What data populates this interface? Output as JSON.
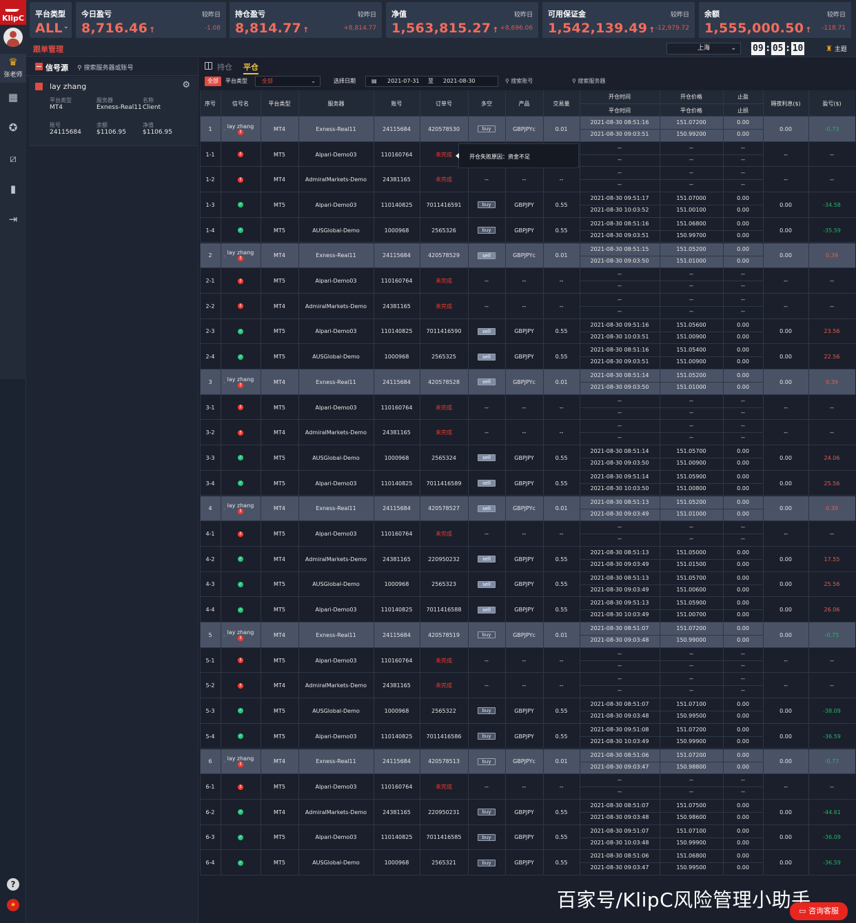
{
  "brand": {
    "logo_text": "KlipC",
    "teacher_label": "张老师",
    "accent": "#e24b40"
  },
  "nav_icons": [
    "dashboard-icon",
    "badge-icon",
    "chart-icon",
    "bar-chart-icon",
    "logout-icon"
  ],
  "footer_icons": {
    "help": "?",
    "flag": "★"
  },
  "stats": [
    {
      "title": "平台类型",
      "value": "ALL",
      "compare": "",
      "delta": ""
    },
    {
      "title": "今日盈亏",
      "value": "8,716.46",
      "compare": "较昨日",
      "delta": "-1.08"
    },
    {
      "title": "持仓盈亏",
      "value": "8,814.77",
      "compare": "较昨日",
      "delta": "+8,814.77"
    },
    {
      "title": "净值",
      "value": "1,563,815.27",
      "compare": "较昨日",
      "delta": "+8,696.06"
    },
    {
      "title": "可用保证金",
      "value": "1,542,139.49",
      "compare": "较昨日",
      "delta": "-12,979.72"
    },
    {
      "title": "余额",
      "value": "1,555,000.50",
      "compare": "较昨日",
      "delta": "-118.71"
    }
  ],
  "subbar": {
    "title": "跟单管理",
    "region": "上海",
    "clock": [
      "09",
      "05",
      "10"
    ],
    "theme": "主题"
  },
  "left_panel": {
    "title": "信号源",
    "search_placeholder": "搜索服务器或账号",
    "trader": {
      "name": "lay zhang",
      "fields": [
        {
          "k": "平台类型",
          "v": "MT4"
        },
        {
          "k": "服务器",
          "v": "Exness-Real11"
        },
        {
          "k": "名称",
          "v": "Client"
        },
        {
          "k": "账号",
          "v": "24115684"
        },
        {
          "k": "余额",
          "v": "$1106.95"
        },
        {
          "k": "净值",
          "v": "$1106.95"
        }
      ]
    }
  },
  "tabs": {
    "hold": "持仓",
    "close": "平仓"
  },
  "filters": {
    "all": "全部",
    "platform_label": "平台类型",
    "platform_value": "全部",
    "date_label": "选择日期",
    "date_from": "2021-07-31",
    "date_sep": "至",
    "date_to": "2021-08-30",
    "search_account": "搜索账号",
    "search_server": "搜索服务器"
  },
  "columns": {
    "idx": "序号",
    "signal": "信号名",
    "platform": "平台类型",
    "server": "服务器",
    "account": "账号",
    "order": "订单号",
    "side": "多空",
    "product": "产品",
    "lots": "交易量",
    "open_time": "开仓时间",
    "close_time": "平仓时间",
    "open_price": "开仓价格",
    "close_price": "平仓价格",
    "sl": "止盈",
    "tp": "止损",
    "swap": "隔夜利息($)",
    "pnl": "盈亏($)"
  },
  "tooltip": "开仓失败原因：资金不足",
  "rows": [
    {
      "idx": "1",
      "name": "lay zhang",
      "status": "warn",
      "platform": "MT4",
      "server": "Exness-Real11",
      "account": "24115684",
      "order": "420578530",
      "side": "buy",
      "product": "GBPJPYc",
      "lots": "0.01",
      "ot": "2021-08-30 08:51:16",
      "ct": "2021-08-30 09:03:51",
      "op": "151.07200",
      "cp": "150.99200",
      "sl": "0.00",
      "tp": "0.00",
      "swap": "0.00",
      "pnl": "-0.73",
      "parent": true
    },
    {
      "idx": "1-1",
      "status": "warn",
      "platform": "MT5",
      "server": "Alpari-Demo03",
      "account": "110160764",
      "order": "未完成",
      "side": "--",
      "product": "--",
      "lots": "--",
      "ot": "--",
      "ct": "--",
      "op": "--",
      "cp": "--",
      "sl": "--",
      "tp": "--",
      "swap": "--",
      "pnl": "--"
    },
    {
      "idx": "1-2",
      "status": "warn",
      "platform": "MT4",
      "server": "AdmiralMarkets-Demo",
      "account": "24381165",
      "order": "未完成",
      "side": "--",
      "product": "--",
      "lots": "--",
      "ot": "--",
      "ct": "--",
      "op": "--",
      "cp": "--",
      "sl": "--",
      "tp": "--",
      "swap": "--",
      "pnl": "--"
    },
    {
      "idx": "1-3",
      "status": "ok",
      "platform": "MT5",
      "server": "Alpari-Demo03",
      "account": "110140825",
      "order": "7011416591",
      "side": "buy",
      "product": "GBPJPY",
      "lots": "0.55",
      "ot": "2021-08-30 09:51:17",
      "ct": "2021-08-30 10:03:52",
      "op": "151.07000",
      "cp": "151.00100",
      "sl": "0.00",
      "tp": "0.00",
      "swap": "0.00",
      "pnl": "-34.58"
    },
    {
      "idx": "1-4",
      "status": "ok",
      "platform": "MT5",
      "server": "AUSGlobal-Demo",
      "account": "1000968",
      "order": "2565326",
      "side": "buy",
      "product": "GBPJPY",
      "lots": "0.55",
      "ot": "2021-08-30 08:51:16",
      "ct": "2021-08-30 09:03:51",
      "op": "151.06800",
      "cp": "150.99700",
      "sl": "0.00",
      "tp": "0.00",
      "swap": "0.00",
      "pnl": "-35.59"
    },
    {
      "idx": "2",
      "name": "lay zhang",
      "status": "warn",
      "platform": "MT4",
      "server": "Exness-Real11",
      "account": "24115684",
      "order": "420578529",
      "side": "sell",
      "product": "GBPJPYc",
      "lots": "0.01",
      "ot": "2021-08-30 08:51:15",
      "ct": "2021-08-30 09:03:50",
      "op": "151.05200",
      "cp": "151.01000",
      "sl": "0.00",
      "tp": "0.00",
      "swap": "0.00",
      "pnl": "0.39",
      "parent": true
    },
    {
      "idx": "2-1",
      "status": "warn",
      "platform": "MT5",
      "server": "Alpari-Demo03",
      "account": "110160764",
      "order": "未完成",
      "side": "--",
      "product": "--",
      "lots": "--",
      "ot": "--",
      "ct": "--",
      "op": "--",
      "cp": "--",
      "sl": "--",
      "tp": "--",
      "swap": "--",
      "pnl": "--"
    },
    {
      "idx": "2-2",
      "status": "warn",
      "platform": "MT4",
      "server": "AdmiralMarkets-Demo",
      "account": "24381165",
      "order": "未完成",
      "side": "--",
      "product": "--",
      "lots": "--",
      "ot": "--",
      "ct": "--",
      "op": "--",
      "cp": "--",
      "sl": "--",
      "tp": "--",
      "swap": "--",
      "pnl": "--"
    },
    {
      "idx": "2-3",
      "status": "ok",
      "platform": "MT5",
      "server": "Alpari-Demo03",
      "account": "110140825",
      "order": "7011416590",
      "side": "sell",
      "product": "GBPJPY",
      "lots": "0.55",
      "ot": "2021-08-30 09:51:16",
      "ct": "2021-08-30 10:03:51",
      "op": "151.05600",
      "cp": "151.00900",
      "sl": "0.00",
      "tp": "0.00",
      "swap": "0.00",
      "pnl": "23.56"
    },
    {
      "idx": "2-4",
      "status": "ok",
      "platform": "MT5",
      "server": "AUSGlobal-Demo",
      "account": "1000968",
      "order": "2565325",
      "side": "sell",
      "product": "GBPJPY",
      "lots": "0.55",
      "ot": "2021-08-30 08:51:16",
      "ct": "2021-08-30 09:03:51",
      "op": "151.05400",
      "cp": "151.00900",
      "sl": "0.00",
      "tp": "0.00",
      "swap": "0.00",
      "pnl": "22.56"
    },
    {
      "idx": "3",
      "name": "lay zhang",
      "status": "warn",
      "platform": "MT4",
      "server": "Exness-Real11",
      "account": "24115684",
      "order": "420578528",
      "side": "sell",
      "product": "GBPJPYc",
      "lots": "0.01",
      "ot": "2021-08-30 08:51:14",
      "ct": "2021-08-30 09:03:50",
      "op": "151.05200",
      "cp": "151.01000",
      "sl": "0.00",
      "tp": "0.00",
      "swap": "0.00",
      "pnl": "0.39",
      "parent": true
    },
    {
      "idx": "3-1",
      "status": "warn",
      "platform": "MT5",
      "server": "Alpari-Demo03",
      "account": "110160764",
      "order": "未完成",
      "side": "--",
      "product": "--",
      "lots": "--",
      "ot": "--",
      "ct": "--",
      "op": "--",
      "cp": "--",
      "sl": "--",
      "tp": "--",
      "swap": "--",
      "pnl": "--"
    },
    {
      "idx": "3-2",
      "status": "warn",
      "platform": "MT4",
      "server": "AdmiralMarkets-Demo",
      "account": "24381165",
      "order": "未完成",
      "side": "--",
      "product": "--",
      "lots": "--",
      "ot": "--",
      "ct": "--",
      "op": "--",
      "cp": "--",
      "sl": "--",
      "tp": "--",
      "swap": "--",
      "pnl": "--"
    },
    {
      "idx": "3-3",
      "status": "ok",
      "platform": "MT5",
      "server": "AUSGlobal-Demo",
      "account": "1000968",
      "order": "2565324",
      "side": "sell",
      "product": "GBPJPY",
      "lots": "0.55",
      "ot": "2021-08-30 08:51:14",
      "ct": "2021-08-30 09:03:50",
      "op": "151.05700",
      "cp": "151.00900",
      "sl": "0.00",
      "tp": "0.00",
      "swap": "0.00",
      "pnl": "24.06"
    },
    {
      "idx": "3-4",
      "status": "ok",
      "platform": "MT5",
      "server": "Alpari-Demo03",
      "account": "110140825",
      "order": "7011416589",
      "side": "sell",
      "product": "GBPJPY",
      "lots": "0.55",
      "ot": "2021-08-30 09:51:14",
      "ct": "2021-08-30 10:03:50",
      "op": "151.05900",
      "cp": "151.00800",
      "sl": "0.00",
      "tp": "0.00",
      "swap": "0.00",
      "pnl": "25.56"
    },
    {
      "idx": "4",
      "name": "lay zhang",
      "status": "warn",
      "platform": "MT4",
      "server": "Exness-Real11",
      "account": "24115684",
      "order": "420578527",
      "side": "sell",
      "product": "GBPJPYc",
      "lots": "0.01",
      "ot": "2021-08-30 08:51:13",
      "ct": "2021-08-30 09:03:49",
      "op": "151.05200",
      "cp": "151.01000",
      "sl": "0.00",
      "tp": "0.00",
      "swap": "0.00",
      "pnl": "0.39",
      "parent": true
    },
    {
      "idx": "4-1",
      "status": "warn",
      "platform": "MT5",
      "server": "Alpari-Demo03",
      "account": "110160764",
      "order": "未完成",
      "side": "--",
      "product": "--",
      "lots": "--",
      "ot": "--",
      "ct": "--",
      "op": "--",
      "cp": "--",
      "sl": "--",
      "tp": "--",
      "swap": "--",
      "pnl": "--"
    },
    {
      "idx": "4-2",
      "status": "ok",
      "platform": "MT4",
      "server": "AdmiralMarkets-Demo",
      "account": "24381165",
      "order": "220950232",
      "side": "sell",
      "product": "GBPJPY",
      "lots": "0.55",
      "ot": "2021-08-30 08:51:13",
      "ct": "2021-08-30 09:03:49",
      "op": "151.05000",
      "cp": "151.01500",
      "sl": "0.00",
      "tp": "0.00",
      "swap": "0.00",
      "pnl": "17.55"
    },
    {
      "idx": "4-3",
      "status": "ok",
      "platform": "MT5",
      "server": "AUSGlobal-Demo",
      "account": "1000968",
      "order": "2565323",
      "side": "sell",
      "product": "GBPJPY",
      "lots": "0.55",
      "ot": "2021-08-30 08:51:13",
      "ct": "2021-08-30 09:03:49",
      "op": "151.05700",
      "cp": "151.00600",
      "sl": "0.00",
      "tp": "0.00",
      "swap": "0.00",
      "pnl": "25.56"
    },
    {
      "idx": "4-4",
      "status": "ok",
      "platform": "MT5",
      "server": "Alpari-Demo03",
      "account": "110140825",
      "order": "7011416588",
      "side": "sell",
      "product": "GBPJPY",
      "lots": "0.55",
      "ot": "2021-08-30 09:51:13",
      "ct": "2021-08-30 10:03:49",
      "op": "151.05900",
      "cp": "151.00700",
      "sl": "0.00",
      "tp": "0.00",
      "swap": "0.00",
      "pnl": "26.06"
    },
    {
      "idx": "5",
      "name": "lay zhang",
      "status": "warn",
      "platform": "MT4",
      "server": "Exness-Real11",
      "account": "24115684",
      "order": "420578519",
      "side": "buy",
      "product": "GBPJPYc",
      "lots": "0.01",
      "ot": "2021-08-30 08:51:07",
      "ct": "2021-08-30 09:03:48",
      "op": "151.07200",
      "cp": "150.99000",
      "sl": "0.00",
      "tp": "0.00",
      "swap": "0.00",
      "pnl": "-0.75",
      "parent": true
    },
    {
      "idx": "5-1",
      "status": "warn",
      "platform": "MT5",
      "server": "Alpari-Demo03",
      "account": "110160764",
      "order": "未完成",
      "side": "--",
      "product": "--",
      "lots": "--",
      "ot": "--",
      "ct": "--",
      "op": "--",
      "cp": "--",
      "sl": "--",
      "tp": "--",
      "swap": "--",
      "pnl": "--"
    },
    {
      "idx": "5-2",
      "status": "warn",
      "platform": "MT4",
      "server": "AdmiralMarkets-Demo",
      "account": "24381165",
      "order": "未完成",
      "side": "--",
      "product": "--",
      "lots": "--",
      "ot": "--",
      "ct": "--",
      "op": "--",
      "cp": "--",
      "sl": "--",
      "tp": "--",
      "swap": "--",
      "pnl": "--"
    },
    {
      "idx": "5-3",
      "status": "ok",
      "platform": "MT5",
      "server": "AUSGlobal-Demo",
      "account": "1000968",
      "order": "2565322",
      "side": "buy",
      "product": "GBPJPY",
      "lots": "0.55",
      "ot": "2021-08-30 08:51:07",
      "ct": "2021-08-30 09:03:48",
      "op": "151.07100",
      "cp": "150.99500",
      "sl": "0.00",
      "tp": "0.00",
      "swap": "0.00",
      "pnl": "-38.09"
    },
    {
      "idx": "5-4",
      "status": "ok",
      "platform": "MT5",
      "server": "Alpari-Demo03",
      "account": "110140825",
      "order": "7011416586",
      "side": "buy",
      "product": "GBPJPY",
      "lots": "0.55",
      "ot": "2021-08-30 09:51:08",
      "ct": "2021-08-30 10:03:49",
      "op": "151.07200",
      "cp": "150.99900",
      "sl": "0.00",
      "tp": "0.00",
      "swap": "0.00",
      "pnl": "-36.59"
    },
    {
      "idx": "6",
      "name": "lay zhang",
      "status": "warn",
      "platform": "MT4",
      "server": "Exness-Real11",
      "account": "24115684",
      "order": "420578513",
      "side": "buy",
      "product": "GBPJPYc",
      "lots": "0.01",
      "ot": "2021-08-30 08:51:06",
      "ct": "2021-08-30 09:03:47",
      "op": "151.07200",
      "cp": "150.98800",
      "sl": "0.00",
      "tp": "0.00",
      "swap": "0.00",
      "pnl": "-0.77",
      "parent": true
    },
    {
      "idx": "6-1",
      "status": "warn",
      "platform": "MT5",
      "server": "Alpari-Demo03",
      "account": "110160764",
      "order": "未完成",
      "side": "--",
      "product": "--",
      "lots": "--",
      "ot": "--",
      "ct": "--",
      "op": "--",
      "cp": "--",
      "sl": "--",
      "tp": "--",
      "swap": "--",
      "pnl": "--"
    },
    {
      "idx": "6-2",
      "status": "ok",
      "platform": "MT4",
      "server": "AdmiralMarkets-Demo",
      "account": "24381165",
      "order": "220950231",
      "side": "buy",
      "product": "GBPJPY",
      "lots": "0.55",
      "ot": "2021-08-30 08:51:07",
      "ct": "2021-08-30 09:03:48",
      "op": "151.07500",
      "cp": "150.98600",
      "sl": "0.00",
      "tp": "0.00",
      "swap": "0.00",
      "pnl": "-44.61"
    },
    {
      "idx": "6-3",
      "status": "ok",
      "platform": "MT5",
      "server": "Alpari-Demo03",
      "account": "110140825",
      "order": "7011416585",
      "side": "buy",
      "product": "GBPJPY",
      "lots": "0.55",
      "ot": "2021-08-30 09:51:07",
      "ct": "2021-08-30 10:03:48",
      "op": "151.07100",
      "cp": "150.99900",
      "sl": "0.00",
      "tp": "0.00",
      "swap": "0.00",
      "pnl": "-36.09"
    },
    {
      "idx": "6-4",
      "status": "ok",
      "platform": "MT5",
      "server": "AUSGlobal-Demo",
      "account": "1000968",
      "order": "2565321",
      "side": "buy",
      "product": "GBPJPY",
      "lots": "0.55",
      "ot": "2021-08-30 08:51:06",
      "ct": "2021-08-30 09:03:47",
      "op": "151.06800",
      "cp": "150.99500",
      "sl": "0.00",
      "tp": "0.00",
      "swap": "0.00",
      "pnl": "-36.59"
    }
  ],
  "watermark": "百家号/KlipC风险管理小助手",
  "support": "咨询客服"
}
